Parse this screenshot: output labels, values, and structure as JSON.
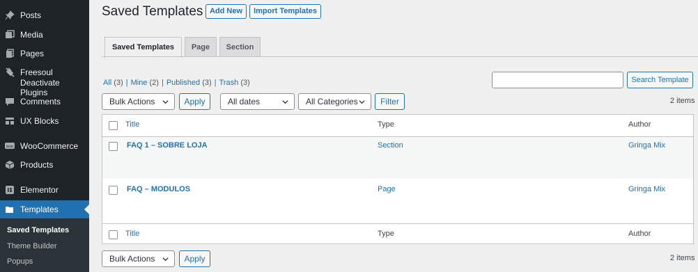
{
  "sidebar": {
    "items": [
      {
        "label": "Posts",
        "icon": "pin-icon"
      },
      {
        "label": "Media",
        "icon": "media-icon"
      },
      {
        "label": "Pages",
        "icon": "pages-icon"
      },
      {
        "label": "Freesoul",
        "label2": "Deactivate Plugins",
        "icon": "plug-icon"
      },
      {
        "label": "Comments",
        "icon": "comments-icon"
      },
      {
        "label": "UX Blocks",
        "icon": "blocks-icon"
      },
      {
        "label": "WooCommerce",
        "icon": "woocommerce-icon"
      },
      {
        "label": "Products",
        "icon": "products-icon"
      },
      {
        "label": "Elementor",
        "icon": "elementor-icon"
      },
      {
        "label": "Templates",
        "icon": "folder-icon"
      }
    ],
    "submenu": [
      "Saved Templates",
      "Theme Builder",
      "Popups"
    ]
  },
  "header": {
    "title": "Saved Templates",
    "add_new": "Add New",
    "import": "Import Templates"
  },
  "tabs": [
    "Saved Templates",
    "Page",
    "Section"
  ],
  "filters_links": {
    "all": "All",
    "all_count": "(3)",
    "mine": "Mine",
    "mine_count": "(2)",
    "published": "Published",
    "published_count": "(3)",
    "trash": "Trash",
    "trash_count": "(3)",
    "sep": "|"
  },
  "search": {
    "value": "",
    "button": "Search Template"
  },
  "toolbar": {
    "bulk_actions": "Bulk Actions",
    "apply": "Apply",
    "dates": "All dates",
    "categories": "All Categories",
    "filter": "Filter",
    "items_count": "2 items"
  },
  "table": {
    "columns": {
      "title": "Title",
      "type": "Type",
      "author": "Author"
    },
    "rows": [
      {
        "title": "FAQ 1 – SOBRE LOJA",
        "type": "Section",
        "author": "Gringa Mix"
      },
      {
        "title": "FAQ – MODULOS",
        "type": "Page",
        "author": "Gringa Mix"
      }
    ]
  },
  "colors": {
    "accent": "#2271b1",
    "sidebar_bg": "#1d2327",
    "page_bg": "#f0f0f1"
  }
}
